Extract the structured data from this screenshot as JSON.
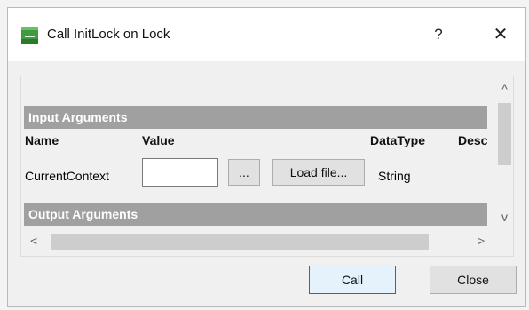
{
  "window": {
    "title": "Call InitLock on Lock",
    "help_label": "?",
    "close_label": "✕"
  },
  "input_section": {
    "header": "Input Arguments",
    "columns": [
      "Name",
      "Value",
      "DataType",
      "Desc"
    ],
    "rows": [
      {
        "name": "CurrentContext",
        "value": "",
        "browse_label": "...",
        "load_label": "Load file...",
        "datatype": "String"
      }
    ]
  },
  "output_section": {
    "header": "Output Arguments"
  },
  "scrollbars": {
    "up": "^",
    "down": "v",
    "left": "<",
    "right": ">"
  },
  "footer": {
    "call_label": "Call",
    "close_label": "Close"
  },
  "icons": [
    "app-icon",
    "help-icon",
    "close-icon"
  ]
}
